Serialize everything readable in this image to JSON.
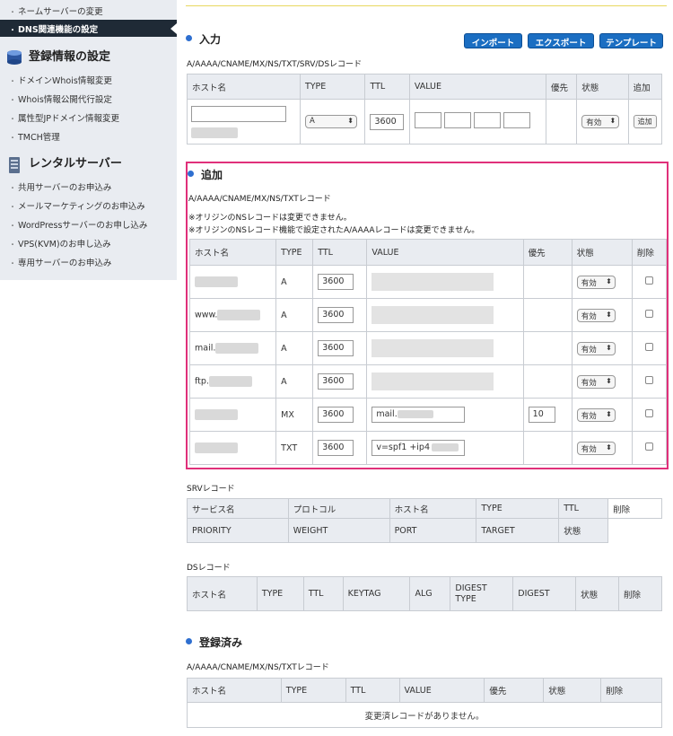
{
  "sidebar": {
    "top_item": "ネームサーバーの変更",
    "active_item": "DNS関連機能の設定",
    "group1_title": "登録情報の設定",
    "group1_items": [
      "ドメインWhois情報変更",
      "Whois情報公開代行設定",
      "属性型JPドメイン情報変更",
      "TMCH管理"
    ],
    "group2_title": "レンタルサーバー",
    "group2_items": [
      "共用サーバーのお申込み",
      "メールマーケティングのお申込み",
      "WordPressサーバーのお申し込み",
      "VPS(KVM)のお申し込み",
      "専用サーバーのお申込み"
    ]
  },
  "input_section": {
    "title": "入力",
    "buttons": {
      "import": "インポート",
      "export": "エクスポート",
      "template": "テンプレート"
    },
    "record_types": "A/AAAA/CNAME/MX/NS/TXT/SRV/DSレコード",
    "headers": [
      "ホスト名",
      "TYPE",
      "TTL",
      "VALUE",
      "優先",
      "状態",
      "追加"
    ],
    "type_value": "A",
    "ttl_value": "3600",
    "status_value": "有効",
    "add_label": "追加"
  },
  "add_section": {
    "title": "追加",
    "record_types": "A/AAAA/CNAME/MX/NS/TXTレコード",
    "note1": "※オリジンのNSレコードは変更できません。",
    "note2": "※オリジンのNSレコード機能で設定されたA/AAAAレコードは変更できません。",
    "headers": [
      "ホスト名",
      "TYPE",
      "TTL",
      "VALUE",
      "優先",
      "状態",
      "削除"
    ],
    "rows": [
      {
        "host_prefix": "",
        "type": "A",
        "ttl": "3600",
        "value": "",
        "priority": "",
        "status": "有効"
      },
      {
        "host_prefix": "www.",
        "type": "A",
        "ttl": "3600",
        "value": "",
        "priority": "",
        "status": "有効"
      },
      {
        "host_prefix": "mail.",
        "type": "A",
        "ttl": "3600",
        "value": "",
        "priority": "",
        "status": "有効"
      },
      {
        "host_prefix": "ftp.",
        "type": "A",
        "ttl": "3600",
        "value": "",
        "priority": "",
        "status": "有効"
      },
      {
        "host_prefix": "",
        "type": "MX",
        "ttl": "3600",
        "value": "mail.",
        "priority": "10",
        "status": "有効"
      },
      {
        "host_prefix": "",
        "type": "TXT",
        "ttl": "3600",
        "value": "v=spf1 +ip4",
        "priority": "",
        "status": "有効"
      }
    ]
  },
  "srv_section": {
    "title": "SRVレコード",
    "headers": [
      "サービス名",
      "プロトコル",
      "ホスト名",
      "TYPE",
      "TTL",
      "削除"
    ],
    "headers2": [
      "PRIORITY",
      "WEIGHT",
      "PORT",
      "TARGET",
      "状態"
    ]
  },
  "ds_section": {
    "title": "DSレコード",
    "headers": [
      "ホスト名",
      "TYPE",
      "TTL",
      "KEYTAG",
      "ALG",
      "DIGEST TYPE",
      "DIGEST",
      "状態",
      "削除"
    ]
  },
  "registered_section": {
    "title": "登録済み",
    "record_types": "A/AAAA/CNAME/MX/NS/TXTレコード",
    "headers": [
      "ホスト名",
      "TYPE",
      "TTL",
      "VALUE",
      "優先",
      "状態",
      "削除"
    ],
    "empty_message": "変更済レコードがありません。"
  }
}
